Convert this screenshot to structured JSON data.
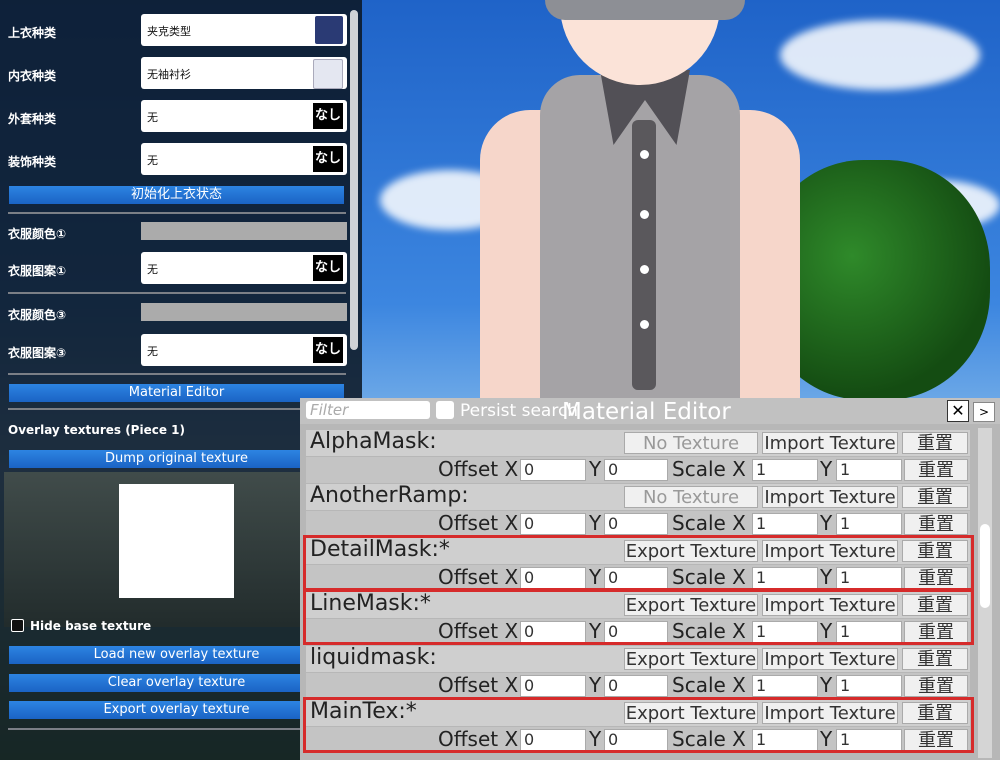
{
  "left_panel": {
    "rows": [
      {
        "label": "上衣种类",
        "value": "夹克类型",
        "swatch": "jacket"
      },
      {
        "label": "内衣种类",
        "value": "无袖衬衫",
        "swatch": "shirt"
      },
      {
        "label": "外套种类",
        "value": "无",
        "tag": "なし"
      },
      {
        "label": "装饰种类",
        "value": "无",
        "tag": "なし"
      }
    ],
    "reset_button": "初始化上衣状态",
    "color1_label": "衣服颜色①",
    "pattern1_label": "衣服图案①",
    "pattern1_value": "无",
    "pattern1_tag": "なし",
    "color3_label": "衣服颜色③",
    "pattern3_label": "衣服图案③",
    "pattern3_value": "无",
    "pattern3_tag": "なし",
    "material_editor_button": "Material Editor",
    "overlay_heading": "Overlay textures (Piece 1)",
    "dump_button": "Dump original texture",
    "hide_base_label": "Hide base texture",
    "load_button": "Load new overlay texture",
    "clear_button": "Clear overlay texture",
    "export_button": "Export overlay texture"
  },
  "material_editor": {
    "filter_placeholder": "Filter",
    "persist_label": "Persist search",
    "title": "Material Editor",
    "close": "✕",
    "next": ">",
    "offset_label": "Offset X",
    "y_label": "Y",
    "scale_label": "Scale X",
    "reset_label": "重置",
    "import_label": "Import Texture",
    "properties": [
      {
        "name": "AlphaMask:",
        "texture_button": "No Texture",
        "offset_x": "0",
        "offset_y": "0",
        "scale_x": "1",
        "scale_y": "1"
      },
      {
        "name": "AnotherRamp:",
        "texture_button": "No Texture",
        "offset_x": "0",
        "offset_y": "0",
        "scale_x": "1",
        "scale_y": "1"
      },
      {
        "name": "DetailMask:*",
        "texture_button": "Export Texture",
        "offset_x": "0",
        "offset_y": "0",
        "scale_x": "1",
        "scale_y": "1"
      },
      {
        "name": "LineMask:*",
        "texture_button": "Export Texture",
        "offset_x": "0",
        "offset_y": "0",
        "scale_x": "1",
        "scale_y": "1"
      },
      {
        "name": "liquidmask:",
        "texture_button": "Export Texture",
        "offset_x": "0",
        "offset_y": "0",
        "scale_x": "1",
        "scale_y": "1"
      },
      {
        "name": "MainTex:*",
        "texture_button": "Export Texture",
        "offset_x": "0",
        "offset_y": "0",
        "scale_x": "1",
        "scale_y": "1"
      }
    ]
  }
}
